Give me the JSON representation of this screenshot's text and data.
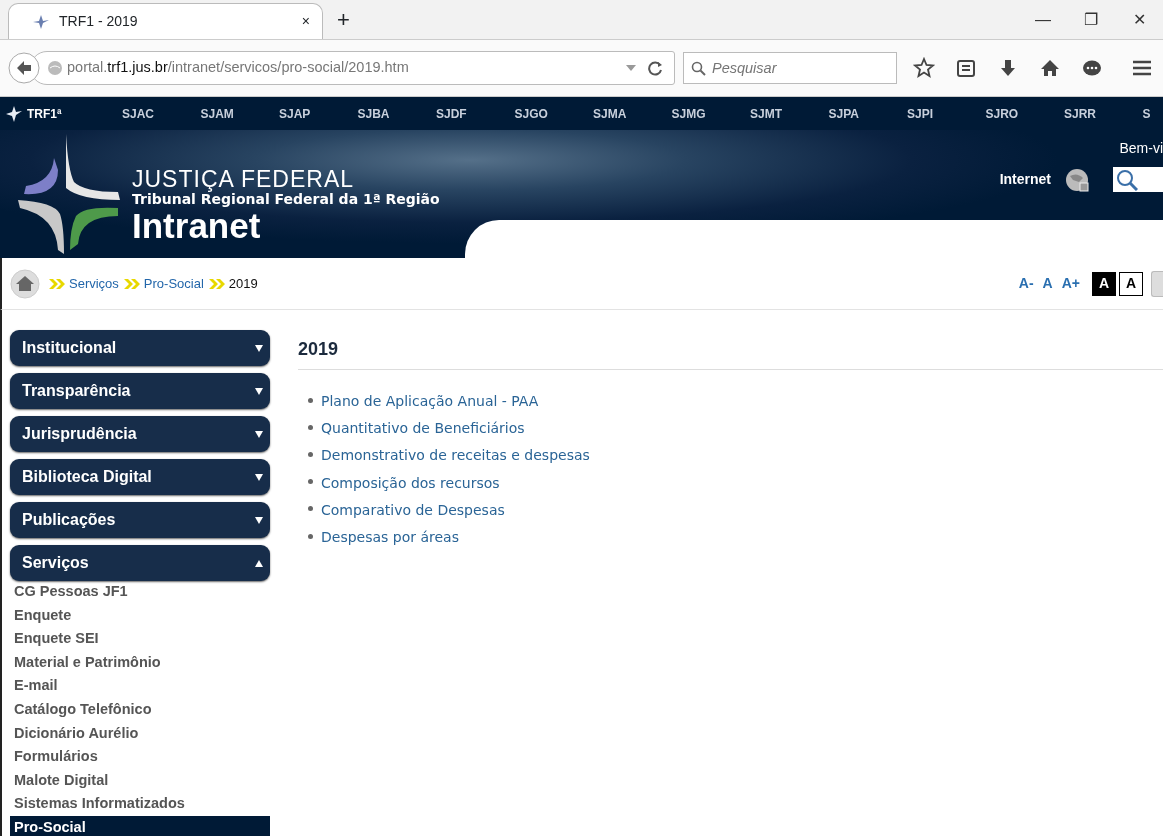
{
  "browser": {
    "tab": {
      "title": "TRF1 - 2019",
      "close": "×"
    },
    "new_tab": "+",
    "window_controls": [
      "—",
      "❐",
      "✕"
    ],
    "url": {
      "host_prefix": "portal.",
      "host": "trf1.jus.br",
      "path": "/intranet/servicos/pro-social/2019.htm"
    },
    "search": {
      "placeholder": "Pesquisar"
    }
  },
  "site_nav": {
    "brand": "TRF1ª",
    "items": [
      "SJAC",
      "SJAM",
      "SJAP",
      "SJBA",
      "SJDF",
      "SJGO",
      "SJMA",
      "SJMG",
      "SJMT",
      "SJPA",
      "SJPI",
      "SJRO",
      "SJRR",
      "S"
    ]
  },
  "header": {
    "title": "JUSTIÇA FEDERAL",
    "subtitle": "Tribunal Regional Federal da 1ª Região",
    "product": "Intranet",
    "welcome": "Bem-vi",
    "internet_label": "Internet"
  },
  "breadcrumb": [
    {
      "label": "Serviços",
      "current": false
    },
    {
      "label": "Pro-Social",
      "current": false
    },
    {
      "label": "2019",
      "current": true
    }
  ],
  "font_controls": [
    {
      "label": "A-",
      "kind": "size"
    },
    {
      "label": "A",
      "kind": "size"
    },
    {
      "label": "A+",
      "kind": "size"
    },
    {
      "label": "A",
      "kind": "dark"
    },
    {
      "label": "A",
      "kind": "light"
    }
  ],
  "sidebar": [
    {
      "label": "Institucional",
      "expanded": false
    },
    {
      "label": "Transparência",
      "expanded": false
    },
    {
      "label": "Jurisprudência",
      "expanded": false
    },
    {
      "label": "Biblioteca Digital",
      "expanded": false
    },
    {
      "label": "Publicações",
      "expanded": false
    },
    {
      "label": "Serviços",
      "expanded": true,
      "children": [
        {
          "label": "CG Pessoas JF1",
          "selected": false
        },
        {
          "label": "Enquete",
          "selected": false
        },
        {
          "label": "Enquete SEI",
          "selected": false
        },
        {
          "label": "Material e Patrimônio",
          "selected": false
        },
        {
          "label": "E-mail",
          "selected": false
        },
        {
          "label": "Catálogo Telefônico",
          "selected": false
        },
        {
          "label": "Dicionário Aurélio",
          "selected": false
        },
        {
          "label": "Formulários",
          "selected": false
        },
        {
          "label": "Malote Digital",
          "selected": false
        },
        {
          "label": "Sistemas Informatizados",
          "selected": false
        },
        {
          "label": "Pro-Social",
          "selected": true
        }
      ]
    }
  ],
  "content": {
    "title": "2019",
    "links": [
      "Plano de Aplicação Anual - PAA",
      "Quantitativo de Beneficiários",
      "Demonstrativo de receitas e despesas",
      "Composição dos recursos",
      "Comparativo de Despesas",
      "Despesas por áreas"
    ]
  }
}
